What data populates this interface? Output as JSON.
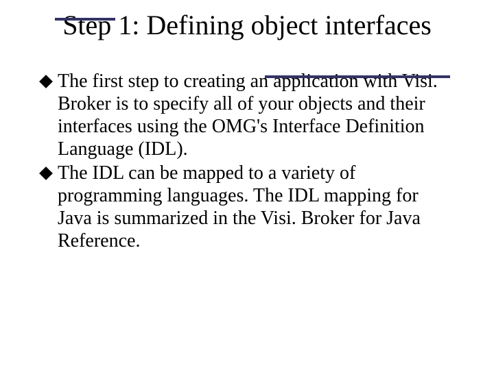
{
  "title": "Step 1: Defining object interfaces",
  "bullets": [
    "The first step to creating an application with Visi. Broker is to specify all of your objects and their interfaces using the OMG's Interface Definition Language (IDL).",
    "The IDL can be mapped to a variety of programming languages. The IDL mapping for Java is summarized in the Visi. Broker for Java Reference."
  ],
  "accent_color": "#333366"
}
